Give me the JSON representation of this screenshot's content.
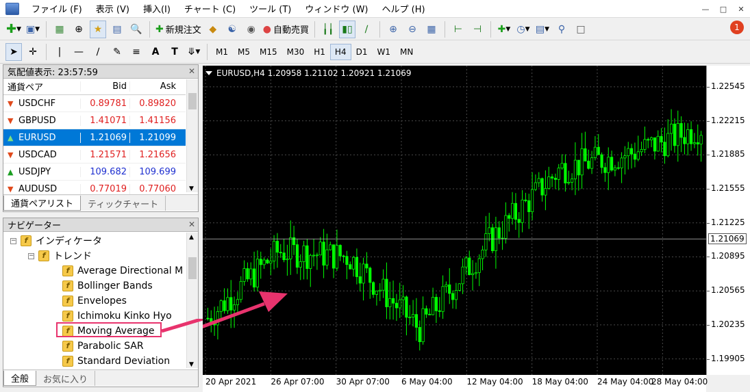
{
  "menu": {
    "items": [
      "ファイル (F)",
      "表示 (V)",
      "挿入(I)",
      "チャート (C)",
      "ツール (T)",
      "ウィンドウ (W)",
      "ヘルプ (H)"
    ]
  },
  "toolbar": {
    "new_order_label": "新規注文",
    "auto_trade_label": "自動売買",
    "notification_count": "1"
  },
  "timeframes": [
    "M1",
    "M5",
    "M15",
    "M30",
    "H1",
    "H4",
    "D1",
    "W1",
    "MN"
  ],
  "timeframe_active": "H4",
  "market_watch": {
    "title": "気配値表示: 23:57:59",
    "col_symbol": "通貨ペア",
    "col_bid": "Bid",
    "col_ask": "Ask",
    "rows": [
      {
        "symbol": "USDCHF",
        "bid": "0.89781",
        "ask": "0.89820",
        "dir": "down",
        "color": "red"
      },
      {
        "symbol": "GBPUSD",
        "bid": "1.41071",
        "ask": "1.41156",
        "dir": "down",
        "color": "red"
      },
      {
        "symbol": "EURUSD",
        "bid": "1.21069",
        "ask": "1.21099",
        "dir": "up",
        "color": "blue",
        "selected": true
      },
      {
        "symbol": "USDCAD",
        "bid": "1.21571",
        "ask": "1.21656",
        "dir": "down",
        "color": "red"
      },
      {
        "symbol": "USDJPY",
        "bid": "109.682",
        "ask": "109.699",
        "dir": "up",
        "color": "blue"
      },
      {
        "symbol": "AUDUSD",
        "bid": "0.77019",
        "ask": "0.77060",
        "dir": "down",
        "color": "red"
      }
    ],
    "tabs": [
      "通貨ペアリスト",
      "ティックチャート"
    ]
  },
  "navigator": {
    "title": "ナビゲーター",
    "items": [
      {
        "label": "インディケータ",
        "level": 1,
        "folder": true
      },
      {
        "label": "トレンド",
        "level": 2,
        "folder": true
      },
      {
        "label": "Average Directional M",
        "level": 3
      },
      {
        "label": "Bollinger Bands",
        "level": 3
      },
      {
        "label": "Envelopes",
        "level": 3
      },
      {
        "label": "Ichimoku Kinko Hyo",
        "level": 3
      },
      {
        "label": "Moving Average",
        "level": 3,
        "highlighted": true
      },
      {
        "label": "Parabolic SAR",
        "level": 3
      },
      {
        "label": "Standard Deviation",
        "level": 3
      }
    ],
    "tabs": [
      "全般",
      "お気に入り"
    ]
  },
  "chart": {
    "header": "EURUSD,H4  1.20958 1.21102 1.20921 1.21069",
    "current_price": "1.21069",
    "price_labels": [
      "1.22545",
      "1.22215",
      "1.21885",
      "1.21555",
      "1.21225",
      "1.20895",
      "1.20565",
      "1.20235",
      "1.19905"
    ],
    "time_labels": [
      "20 Apr 2021",
      "26 Apr 07:00",
      "30 Apr 07:00",
      "6 May 04:00",
      "12 May 04:00",
      "18 May 04:00",
      "24 May 04:00",
      "28 May 04:00"
    ],
    "colors": {
      "bull": "#00ff00",
      "bear": "#00ff00",
      "background": "#000000",
      "grid": "#4a4a4a",
      "annotation": "#e8336d"
    }
  },
  "chart_data": {
    "type": "line",
    "title": "EURUSD,H4",
    "xlabel": "",
    "ylabel": "",
    "ylim": [
      1.1975,
      1.2275
    ],
    "x": [
      "20 Apr 2021",
      "26 Apr 07:00",
      "30 Apr 07:00",
      "6 May 04:00",
      "12 May 04:00",
      "18 May 04:00",
      "24 May 04:00",
      "28 May 04:00"
    ],
    "series": [
      {
        "values": [
          1.203,
          1.2095,
          1.209,
          1.202,
          1.2105,
          1.2175,
          1.219,
          1.2215
        ]
      }
    ],
    "grid": true
  }
}
